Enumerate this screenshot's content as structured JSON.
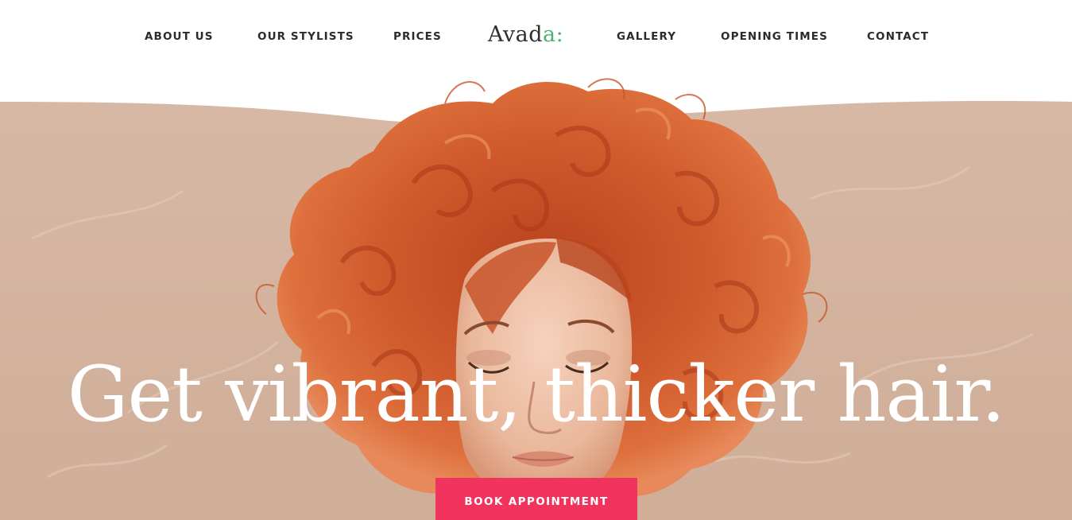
{
  "nav": {
    "about": "ABOUT US",
    "stylists": "OUR STYLISTS",
    "prices": "PRICES",
    "gallery": "GALLERY",
    "opening": "OPENING TIMES",
    "contact": "CONTACT"
  },
  "logo": {
    "text_main": "Avad",
    "text_accent": "a:"
  },
  "hero": {
    "headline": "Get vibrant, thicker hair.",
    "cta_label": "BOOK APPOINTMENT",
    "image": "red-curly-hair-woman-photo"
  },
  "colors": {
    "accent_green": "#4fb26f",
    "cta_pink": "#f0345e",
    "hero_bg": "#d4b4a0",
    "hair": "#c9552a"
  }
}
